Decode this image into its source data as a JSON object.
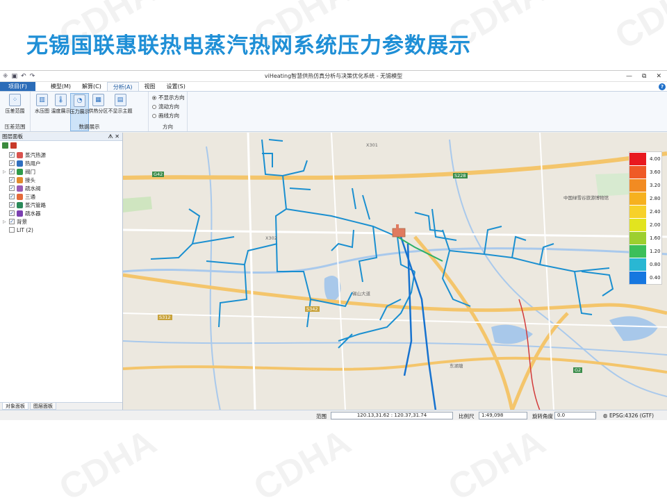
{
  "slide": {
    "title": "无锡国联惠联热电蒸汽热网系统压力参数展示",
    "watermark": "CDHA"
  },
  "window": {
    "title": "viHeating智慧供热仿真分析与决策优化系统 - 无锡模型",
    "minimize": "—",
    "restore": "⧉",
    "close": "✕"
  },
  "menu": {
    "file": "项目(F)",
    "tabs": [
      "模型(M)",
      "解算(C)",
      "分析(A)",
      "视图",
      "设置(S)"
    ],
    "active": "分析(A)",
    "help": "?"
  },
  "ribbon": {
    "groups": [
      {
        "label": "压差范围",
        "buttons": [
          "压差范围"
        ]
      },
      {
        "label": "数据展示",
        "buttons": [
          "水压图",
          "温度展示",
          "压力展示",
          "供热分区",
          "不显示主题"
        ]
      },
      {
        "label": "方向",
        "radios": [
          "不显示方向",
          "流动方向",
          "画线方向"
        ]
      }
    ],
    "selected_button": "压力展示",
    "selected_radio": "不显示方向"
  },
  "layer_panel": {
    "title": "图层面板",
    "controls": "ᗑ ✕",
    "items": [
      {
        "label": "蒸汽热源",
        "checked": true,
        "expand": false,
        "color": "#d9534f"
      },
      {
        "label": "热用户",
        "checked": true,
        "expand": false,
        "color": "#2f6fbf"
      },
      {
        "label": "阀门",
        "checked": true,
        "expand": true,
        "color": "#2e9b4a"
      },
      {
        "label": "接头",
        "checked": true,
        "expand": false,
        "color": "#e28a2c"
      },
      {
        "label": "疏水阀",
        "checked": true,
        "expand": false,
        "color": "#9a5cb4"
      },
      {
        "label": "三通",
        "checked": true,
        "expand": false,
        "color": "#e46a3a"
      },
      {
        "label": "蒸汽管路",
        "checked": true,
        "expand": false,
        "color": "#2b8a5a"
      },
      {
        "label": "疏水器",
        "checked": true,
        "expand": false,
        "color": "#7b3fb0"
      },
      {
        "label": "背景",
        "checked": true,
        "expand": true,
        "color": ""
      },
      {
        "label": "LIT (2)",
        "checked": false,
        "expand": false,
        "color": ""
      }
    ],
    "tabs": [
      "对象面板",
      "图层面板"
    ]
  },
  "map": {
    "labels": [
      "中国绿雪谷旅游博物馆",
      "锡山大道",
      "G42",
      "S228",
      "G2",
      "X301",
      "S342",
      "X302",
      "S312",
      "东湖塘"
    ],
    "heat_source_color": "#e07a5f",
    "pipe_color": "#1a8fd0"
  },
  "legend": {
    "items": [
      {
        "value": "4.00",
        "color": "#e8191f"
      },
      {
        "value": "3.60",
        "color": "#ef5a27"
      },
      {
        "value": "3.20",
        "color": "#f28b22"
      },
      {
        "value": "2.80",
        "color": "#f6b11f"
      },
      {
        "value": "2.40",
        "color": "#f7d12a"
      },
      {
        "value": "2.00",
        "color": "#e2e41f"
      },
      {
        "value": "1.60",
        "color": "#9dcf2f"
      },
      {
        "value": "1.20",
        "color": "#3cbf59"
      },
      {
        "value": "0.80",
        "color": "#29b7d3"
      },
      {
        "value": "0.40",
        "color": "#1677e0"
      }
    ]
  },
  "status": {
    "range_label": "范围",
    "range_value": "120.13,31.62 : 120.37,31.74",
    "scale_label": "比例尺",
    "scale_value": "1:49,098",
    "rotation_label": "旋转角度",
    "rotation_value": "0.0",
    "crs": "EPSG:4326 (GTF)"
  }
}
